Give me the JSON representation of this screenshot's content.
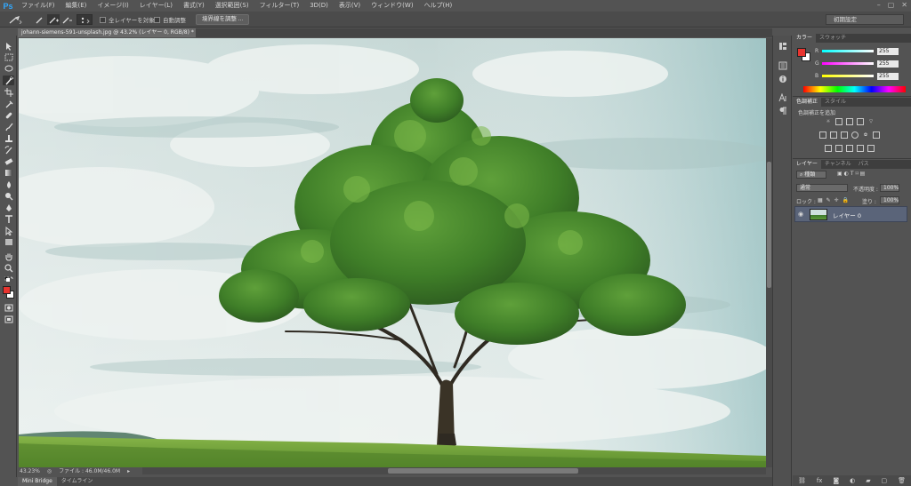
{
  "app": {
    "logo": "Ps",
    "menu": [
      "ファイル(F)",
      "編集(E)",
      "イメージ(I)",
      "レイヤー(L)",
      "書式(Y)",
      "選択範囲(S)",
      "フィルター(T)",
      "3D(D)",
      "表示(V)",
      "ウィンドウ(W)",
      "ヘルプ(H)"
    ],
    "window_controls": [
      "–",
      "▢",
      "✕"
    ]
  },
  "options_bar": {
    "sample_all_layers": "全レイヤーを対象",
    "auto_enhance": "自動調整",
    "refine_edge": "境界線を調整 ...",
    "workspace": "初期設定"
  },
  "document": {
    "tab_title": "johann-siemens-591-unsplash.jpg  @ 43.2% (レイヤー 0, RGB/8) *",
    "tab_close": "×",
    "zoom": "43.23%",
    "file_info": "ファイル : 46.0M/46.0M"
  },
  "bottom_tabs": [
    "Mini Bridge",
    "タイムライン"
  ],
  "color_panel": {
    "tabs": [
      "カラー",
      "スウォッチ"
    ],
    "channels": [
      {
        "label": "R",
        "value": "255",
        "color": "#ff5a5a"
      },
      {
        "label": "G",
        "value": "255",
        "color": "#c040c0"
      },
      {
        "label": "B",
        "value": "255",
        "color": "#e8e820"
      }
    ],
    "foreground": "#e8342f",
    "background": "#ffffff"
  },
  "adjustments_panel": {
    "tabs": [
      "色調補正",
      "スタイル"
    ],
    "heading": "色調補正を追加"
  },
  "layers_panel": {
    "tabs": [
      "レイヤー",
      "チャンネル",
      "パス"
    ],
    "filter": "種類",
    "blend_mode": "通常",
    "opacity_label": "不透明度 :",
    "opacity": "100%",
    "lock_label": "ロック :",
    "fill_label": "塗り :",
    "fill": "100%",
    "layers": [
      {
        "name": "レイヤー 0"
      }
    ]
  }
}
